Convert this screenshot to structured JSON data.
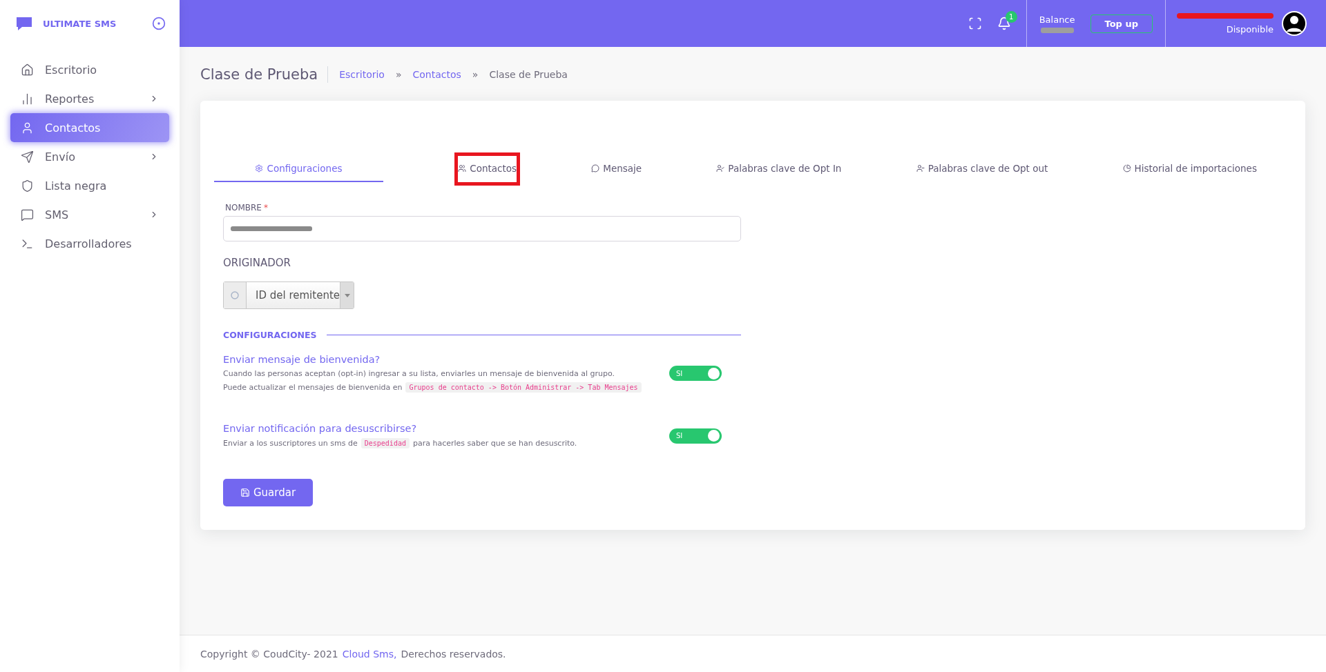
{
  "brand": {
    "name": "ULTIMATE SMS"
  },
  "header": {
    "notification_count": "1",
    "balance_label": "Balance",
    "top_up": "Top up",
    "user_status": "Disponible"
  },
  "sidebar": {
    "items": [
      {
        "label": "Escritorio",
        "has_children": false,
        "selected": false
      },
      {
        "label": "Reportes",
        "has_children": true,
        "selected": false
      },
      {
        "label": "Contactos",
        "has_children": false,
        "selected": true
      },
      {
        "label": "Envío",
        "has_children": true,
        "selected": false
      },
      {
        "label": "Lista negra",
        "has_children": false,
        "selected": false
      },
      {
        "label": "SMS",
        "has_children": true,
        "selected": false
      },
      {
        "label": "Desarrolladores",
        "has_children": false,
        "selected": false
      }
    ]
  },
  "page": {
    "title": "Clase de Prueba",
    "separator": "»",
    "breadcrumbs": [
      {
        "label": "Escritorio",
        "link": true
      },
      {
        "label": "Contactos",
        "link": true
      },
      {
        "label": "Clase de Prueba",
        "link": false
      }
    ]
  },
  "tabs": [
    {
      "label": "Configuraciones",
      "selected": true,
      "highlighted": false
    },
    {
      "label": "Contactos",
      "selected": false,
      "highlighted": true
    },
    {
      "label": "Mensaje",
      "selected": false,
      "highlighted": false
    },
    {
      "label": "Palabras clave de Opt In",
      "selected": false,
      "highlighted": false
    },
    {
      "label": "Palabras clave de Opt out",
      "selected": false,
      "highlighted": false
    },
    {
      "label": "Historial de importaciones",
      "selected": false,
      "highlighted": false
    }
  ],
  "form": {
    "name_label": "NOMBRE",
    "required_mark": "*",
    "originator_label": "ORIGINADOR",
    "originator_value": "ID del remitente",
    "section_title": "CONFIGURACIONES",
    "settings": [
      {
        "title": "Enviar mensaje de bienvenida?",
        "on": true,
        "switch_label": "SI",
        "lines": [
          [
            {
              "kind": "text",
              "text": "Cuando las personas aceptan (opt-in) ingresar a su lista, enviarles un mensaje de bienvenida al grupo."
            }
          ],
          [
            {
              "kind": "text",
              "text": "Puede actualizar el mensajes de bienvenida en"
            },
            {
              "kind": "tag",
              "text": "Grupos de contacto -> Botón Administrar -> Tab Mensajes"
            }
          ]
        ]
      },
      {
        "title": "Enviar notificación para desuscribirse?",
        "on": true,
        "switch_label": "SI",
        "lines": [
          [
            {
              "kind": "text",
              "text": "Enviar a los suscriptores un sms de"
            },
            {
              "kind": "tag",
              "text": "Despedidad"
            },
            {
              "kind": "text",
              "text": "para hacerles saber que se han desuscrito."
            }
          ]
        ]
      }
    ],
    "save_button": "Guardar"
  },
  "footer": {
    "copyright": "Copyright © CoudCity- 2021",
    "link": "Cloud Sms,",
    "rights": "Derechos reservados."
  }
}
